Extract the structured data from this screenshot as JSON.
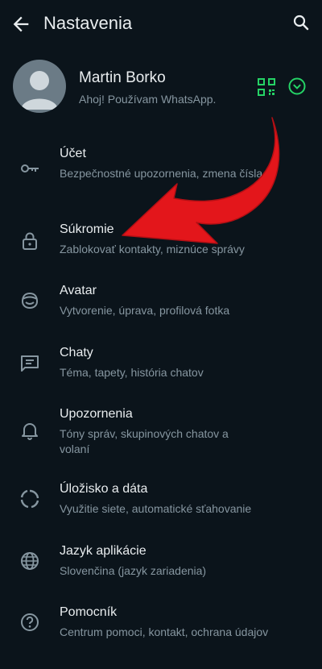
{
  "header": {
    "title": "Nastavenia",
    "back_icon": "arrow-left-icon",
    "search_icon": "search-icon"
  },
  "profile": {
    "name": "Martin Borko",
    "status": "Ahoj! Používam WhatsApp.",
    "accent": "#25d366"
  },
  "items": [
    {
      "label": "Účet",
      "sub": "Bezpečnostné upozornenia, zmena čísla",
      "icon": "key-icon"
    },
    {
      "label": "Súkromie",
      "sub": "Zablokovať kontakty, miznúce správy",
      "icon": "lock-icon"
    },
    {
      "label": "Avatar",
      "sub": "Vytvorenie, úprava, profilová fotka",
      "icon": "avatar-icon"
    },
    {
      "label": "Chaty",
      "sub": "Téma, tapety, história chatov",
      "icon": "chat-icon"
    },
    {
      "label": "Upozornenia",
      "sub": "Tóny správ, skupinových chatov a volaní",
      "icon": "bell-icon"
    },
    {
      "label": "Úložisko a dáta",
      "sub": "Využitie siete, automatické sťahovanie",
      "icon": "storage-icon"
    },
    {
      "label": "Jazyk aplikácie",
      "sub": "Slovenčina (jazyk zariadenia)",
      "icon": "globe-icon"
    },
    {
      "label": "Pomocník",
      "sub": "Centrum pomoci, kontakt, ochrana údajov",
      "icon": "help-icon"
    }
  ],
  "annotation": {
    "arrow_color": "#e3161b"
  }
}
